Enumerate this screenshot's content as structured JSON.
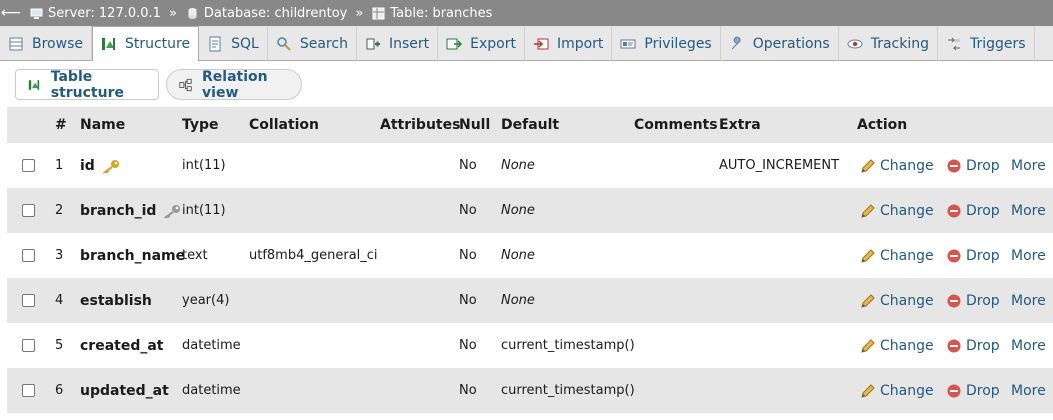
{
  "breadcrumb": {
    "server": "Server: 127.0.0.1",
    "database": "Database: childrentoy",
    "table": "Table: branches",
    "separator": "»"
  },
  "tabs": [
    {
      "label": "Browse",
      "icon": "browse-icon"
    },
    {
      "label": "Structure",
      "icon": "structure-icon"
    },
    {
      "label": "SQL",
      "icon": "sql-icon"
    },
    {
      "label": "Search",
      "icon": "search-icon"
    },
    {
      "label": "Insert",
      "icon": "insert-icon"
    },
    {
      "label": "Export",
      "icon": "export-icon"
    },
    {
      "label": "Import",
      "icon": "import-icon"
    },
    {
      "label": "Privileges",
      "icon": "privileges-icon"
    },
    {
      "label": "Operations",
      "icon": "wrench-icon"
    },
    {
      "label": "Tracking",
      "icon": "eye-icon"
    },
    {
      "label": "Triggers",
      "icon": "triggers-icon"
    }
  ],
  "active_tab": "Structure",
  "subtabs": {
    "table_structure": "Table structure",
    "relation_view": "Relation view"
  },
  "table": {
    "headers": {
      "num": "#",
      "name": "Name",
      "type": "Type",
      "collation": "Collation",
      "attributes": "Attributes",
      "null": "Null",
      "default": "Default",
      "comments": "Comments",
      "extra": "Extra",
      "action": "Action"
    },
    "actions": {
      "change": "Change",
      "drop": "Drop",
      "more": "More"
    },
    "rows": [
      {
        "num": "1",
        "name": "id",
        "type": "int(11)",
        "collation": "",
        "attributes": "",
        "null": "No",
        "default": "None",
        "comments": "",
        "extra": "AUTO_INCREMENT",
        "key": "primary"
      },
      {
        "num": "2",
        "name": "branch_id",
        "type": "int(11)",
        "collation": "",
        "attributes": "",
        "null": "No",
        "default": "None",
        "comments": "",
        "extra": "",
        "key": "index"
      },
      {
        "num": "3",
        "name": "branch_name",
        "type": "text",
        "collation": "utf8mb4_general_ci",
        "attributes": "",
        "null": "No",
        "default": "None",
        "comments": "",
        "extra": "",
        "key": ""
      },
      {
        "num": "4",
        "name": "establish",
        "type": "year(4)",
        "collation": "",
        "attributes": "",
        "null": "No",
        "default": "None",
        "comments": "",
        "extra": "",
        "key": ""
      },
      {
        "num": "5",
        "name": "created_at",
        "type": "datetime",
        "collation": "",
        "attributes": "",
        "null": "No",
        "default": "current_timestamp()",
        "comments": "",
        "extra": "",
        "key": ""
      },
      {
        "num": "6",
        "name": "updated_at",
        "type": "datetime",
        "collation": "",
        "attributes": "",
        "null": "No",
        "default": "current_timestamp()",
        "comments": "",
        "extra": "",
        "key": ""
      }
    ]
  },
  "colors": {
    "link": "#235a81",
    "breadcrumb_bg": "#888888",
    "row_alt": "#e6e6e6",
    "drop_red": "#d9534f",
    "key_gold": "#d8a520"
  }
}
